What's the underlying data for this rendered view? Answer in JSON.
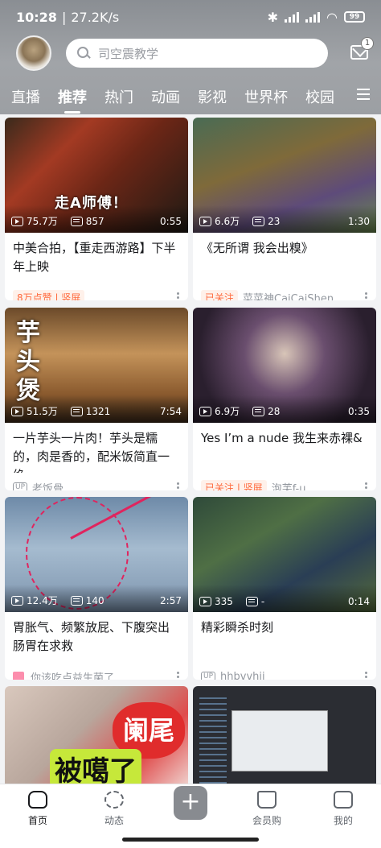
{
  "status_bar": {
    "time": "10:28",
    "speed": "27.2K/s",
    "battery": "99"
  },
  "search": {
    "placeholder": "司空震教学"
  },
  "notifications": {
    "badge": "1"
  },
  "tabs": [
    {
      "label": "直播",
      "active": false
    },
    {
      "label": "推荐",
      "active": true
    },
    {
      "label": "热门",
      "active": false
    },
    {
      "label": "动画",
      "active": false
    },
    {
      "label": "影视",
      "active": false
    },
    {
      "label": "世界杯",
      "active": false
    },
    {
      "label": "校园",
      "active": false
    }
  ],
  "cards": [
    {
      "thumb_caption": "走A师傅！",
      "views": "75.7万",
      "danmaku": "857",
      "duration": "0:55",
      "title": "中美合拍，【重走西游路】下半年上映",
      "tag": "8万点赞 | 竖屏",
      "author": ""
    },
    {
      "thumb_caption": "",
      "views": "6.6万",
      "danmaku": "23",
      "duration": "1:30",
      "title": "《无所谓 我会出糗》",
      "tag": "已关注",
      "author": "菜菜神CaiCaiShen"
    },
    {
      "thumb_caption": "芋头煲",
      "views": "51.5万",
      "danmaku": "1321",
      "duration": "7:54",
      "title": "一片芋头一片肉！芋头是糯的，肉是香的，配米饭简直一绝~...",
      "tag": "",
      "author": "老饭骨",
      "up_label": "UP"
    },
    {
      "thumb_caption": "",
      "views": "6.9万",
      "danmaku": "28",
      "duration": "0:35",
      "title": "Yes I’m a nude 我生来赤裸&",
      "tag": "已关注 | 竖屏",
      "author": "泡芙f-u"
    },
    {
      "thumb_caption": "",
      "views": "12.4万",
      "danmaku": "140",
      "duration": "2:57",
      "title": "胃胀气、频繁放屁、下腹突出肠胃在求救",
      "tag": "",
      "author": "你该吃点益生菌了"
    },
    {
      "thumb_caption": "",
      "views": "335",
      "danmaku": "-",
      "duration": "0:14",
      "title": "精彩瞬杀时刻",
      "tag": "",
      "author": "hhbvvhjj",
      "up_label": "UP"
    },
    {
      "thumb_caption": "被噶了",
      "thumb_caption2": "阑尾",
      "views": "",
      "danmaku": "",
      "duration": "",
      "title": "",
      "tag": "",
      "author": ""
    },
    {
      "thumb_caption": "",
      "views": "",
      "danmaku": "",
      "duration": "",
      "title": "",
      "tag": "",
      "author": ""
    }
  ],
  "bottom_nav": [
    {
      "label": "首页",
      "icon": "home-icon",
      "active": true
    },
    {
      "label": "动态",
      "icon": "pinwheel-icon",
      "active": false
    },
    {
      "label": "+",
      "icon": "plus-icon",
      "active": false
    },
    {
      "label": "会员购",
      "icon": "shopping-bag-icon",
      "active": false
    },
    {
      "label": "我的",
      "icon": "tv-icon",
      "active": false
    }
  ]
}
